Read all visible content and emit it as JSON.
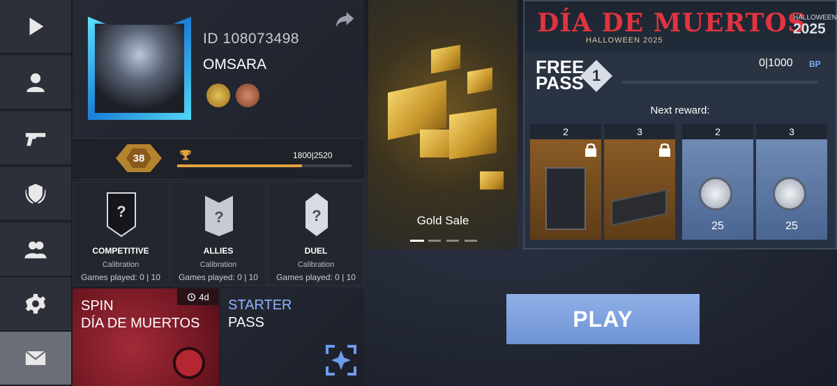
{
  "sidebar": {
    "items": [
      {
        "name": "play",
        "icon": "play-icon"
      },
      {
        "name": "profile",
        "icon": "person-icon"
      },
      {
        "name": "arsenal",
        "icon": "pistol-icon"
      },
      {
        "name": "clan",
        "icon": "shield-laurel-icon"
      },
      {
        "name": "friends",
        "icon": "group-icon"
      },
      {
        "name": "settings",
        "icon": "gear-icon"
      },
      {
        "name": "mail",
        "icon": "envelope-icon"
      }
    ],
    "active_index": 6
  },
  "profile": {
    "id_text": "ID 108073498",
    "name": "OMSARA",
    "level": "38",
    "xp_text": "1800|2520",
    "xp_fraction": 0.714
  },
  "ranks": [
    {
      "title": "COMPETITIVE",
      "status": "Calibration",
      "games": "Games played: 0 | 10",
      "badge": "?"
    },
    {
      "title": "ALLIES",
      "status": "Calibration",
      "games": "Games played: 0 | 10",
      "badge": "?"
    },
    {
      "title": "DUEL",
      "status": "Calibration",
      "games": "Games played: 0 | 10",
      "badge": "?"
    }
  ],
  "spin": {
    "line1": "SPIN",
    "line2": "DÍA DE MUERTOS",
    "timer": "4d"
  },
  "starter": {
    "line1": "STARTER",
    "line2": "PASS"
  },
  "gold_sale": {
    "label": "Gold Sale"
  },
  "event": {
    "title": "DÍA DE MUERTOS",
    "subtitle": "HALLOWEEN 2025",
    "tag_small": "HALLOWEEN",
    "tag_year": "2025",
    "pass_line1": "FREE",
    "pass_line2": "PASS",
    "tier": "1",
    "bp_text": "0|1000",
    "bp_unit": "BP",
    "next_reward": "Next reward:",
    "rewards": [
      {
        "tier": "2",
        "type": "locked",
        "amount": ""
      },
      {
        "tier": "3",
        "type": "locked",
        "amount": ""
      },
      {
        "tier": "2",
        "type": "coin",
        "amount": "25"
      },
      {
        "tier": "3",
        "type": "coin",
        "amount": "25"
      }
    ]
  },
  "play_button": "PLAY"
}
